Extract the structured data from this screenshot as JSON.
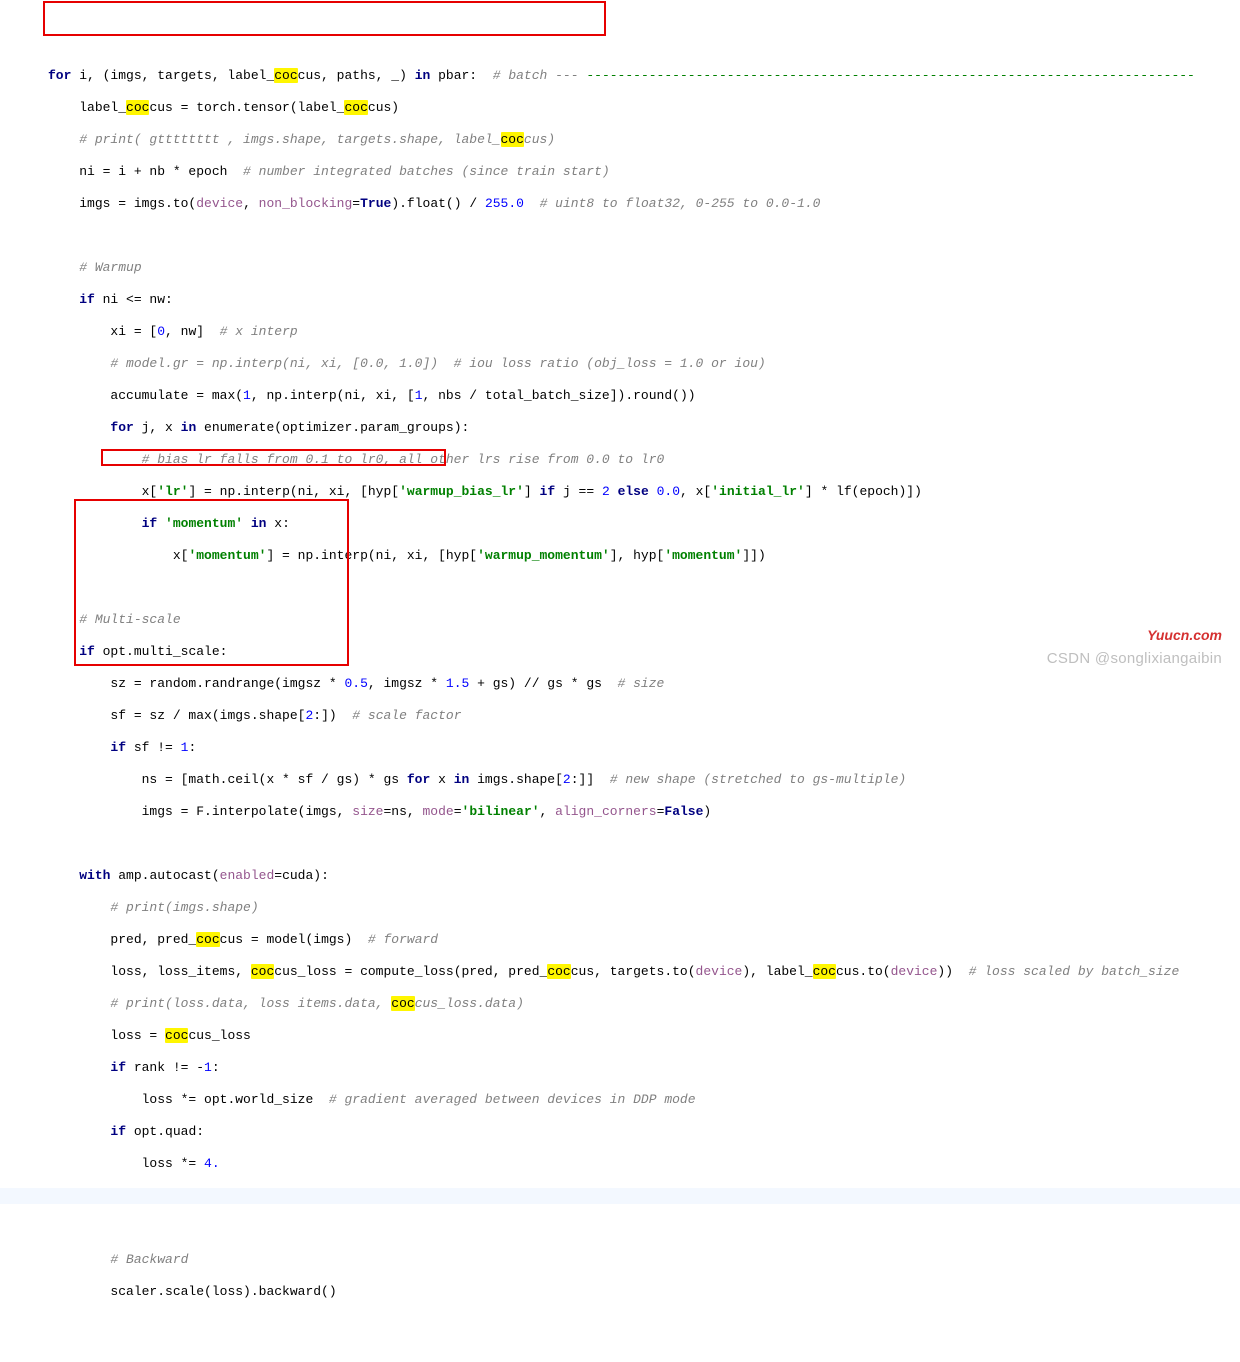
{
  "tokens": {
    "l01": {
      "pre": "",
      "a": "for",
      "b": " i, (imgs, targets, label_",
      "h1": "coc",
      "c": "cus, paths, _) ",
      "d": "in",
      "e": " pbar:  ",
      "cm": "# batch ---",
      "dash": " ------------------------------------------------------------------------------"
    },
    "l02": {
      "pre": "    ",
      "a": "label_",
      "h1": "coc",
      "b": "cus = torch.tensor(label_",
      "h2": "coc",
      "c": "cus)"
    },
    "l03": {
      "pre": "    ",
      "a": "# print( gtttttttt , imgs.shape, targets.shape, label_",
      "h": "coc",
      "b": "cus)"
    },
    "l04": {
      "pre": "    ",
      "a": "ni = i + nb * epoch  ",
      "cm": "# number integrated batches (since train start)"
    },
    "l05": {
      "pre": "    ",
      "a": "imgs = imgs.to(",
      "self": "device",
      "b": ", ",
      "kw": "non_blocking",
      "eq": "=",
      "tr": "True",
      "c": ").float() / ",
      "num": "255.0",
      "sp": "  ",
      "cm": "# uint8 to float32, 0-255 to 0.0-1.0"
    },
    "l07": {
      "pre": "    ",
      "cm": "# Warmup"
    },
    "l08": {
      "pre": "    ",
      "a": "if",
      "b": " ni <= nw:"
    },
    "l09": {
      "pre": "        ",
      "a": "xi = [",
      "n1": "0",
      "b": ", nw]  ",
      "cm": "# x interp"
    },
    "l10": {
      "pre": "        ",
      "cm": "# model.gr = np.interp(ni, xi, [0.0, 1.0])  # iou loss ratio (obj_loss = 1.0 or iou)"
    },
    "l11": {
      "pre": "        ",
      "a": "accumulate = max(",
      "n1": "1",
      "b": ", np.interp(ni, xi, [",
      "n2": "1",
      "c": ", nbs / total_batch_size]).round())"
    },
    "l12": {
      "pre": "        ",
      "a": "for",
      "b": " j, x ",
      "c": "in",
      "d": " enumerate(optimizer.param_groups):"
    },
    "l13": {
      "pre": "            ",
      "cm": "# bias lr falls from 0.1 to lr0, all other lrs rise from 0.0 to lr0"
    },
    "l14": {
      "pre": "            ",
      "a": "x[",
      "s1": "'lr'",
      "b": "] = np.interp(ni, xi, [hyp[",
      "s2": "'warmup_bias_lr'",
      "c": "] ",
      "if": "if",
      "d": " j == ",
      "n": "2",
      "sp": " ",
      "el": "else",
      "e": " ",
      "z": "0.0",
      "f": ", x[",
      "s3": "'initial_lr'",
      "g": "] * lf(epoch)])"
    },
    "l15": {
      "pre": "            ",
      "a": "if",
      "b": " ",
      "s": "'momentum'",
      "c": " ",
      "d": "in",
      "e": " x:"
    },
    "l16": {
      "pre": "                ",
      "a": "x[",
      "s1": "'momentum'",
      "b": "] = np.interp(ni, xi, [hyp[",
      "s2": "'warmup_momentum'",
      "c": "], hyp[",
      "s3": "'momentum'",
      "d": "]])"
    },
    "l18": {
      "pre": "    ",
      "cm": "# Multi-scale"
    },
    "l19": {
      "pre": "    ",
      "a": "if",
      "b": " opt.multi_scale:"
    },
    "l20": {
      "pre": "        ",
      "a": "sz = random.randrange(imgsz * ",
      "n1": "0.5",
      "b": ", imgsz * ",
      "n2": "1.5",
      "c": " + gs) // gs * gs  ",
      "cm": "# size"
    },
    "l21": {
      "pre": "        ",
      "a": "sf = sz / max(imgs.shape[",
      "n": "2",
      "b": ":])  ",
      "cm": "# scale factor"
    },
    "l22": {
      "pre": "        ",
      "a": "if",
      "b": " sf != ",
      "n": "1",
      "c": ":"
    },
    "l23": {
      "pre": "            ",
      "a": "ns = [math.ceil(x * sf / gs) * gs ",
      "fr": "for",
      "b": " x ",
      "in": "in",
      "c": " imgs.shape[",
      "n": "2",
      "d": ":]]  ",
      "cm": "# new shape (stretched to gs-multiple)"
    },
    "l24": {
      "pre": "            ",
      "a": "imgs = F.interpolate(imgs, ",
      "k1": "size",
      "eq1": "=ns, ",
      "k2": "mode",
      "eq2": "=",
      "s": "'bilinear'",
      "b": ", ",
      "k3": "align_corners",
      "eq3": "=",
      "fl": "False",
      "c": ")"
    },
    "l26": {
      "pre": "    ",
      "a": "with",
      "b": " amp.autocast(",
      "k": "enabled",
      "c": "=cuda):"
    },
    "l27": {
      "pre": "        ",
      "cm": "# print(imgs.shape)"
    },
    "l28": {
      "pre": "        ",
      "a": "pred, pred_",
      "h": "coc",
      "b": "cus = model(imgs)  ",
      "cm": "# forward"
    },
    "l29": {
      "pre": "        ",
      "a": "loss, loss_items, ",
      "h1": "coc",
      "b": "cus_loss = compute_loss(pred, pred_",
      "h2": "coc",
      "c": "cus, targets.to(",
      "self": "device",
      "d": "), label_",
      "h3": "coc",
      "e": "cus.to(",
      "self2": "device",
      "f": "))  ",
      "cm": "# loss scaled by batch_size"
    },
    "l30": {
      "pre": "        ",
      "a": "# print(loss.data, loss items.data, ",
      "h": "coc",
      "b": "cus_loss.data)"
    },
    "l31": {
      "pre": "        ",
      "a": "loss = ",
      "h": "coc",
      "b": "cus_loss"
    },
    "l32": {
      "pre": "        ",
      "a": "if",
      "b": " rank != -",
      "n": "1",
      "c": ":"
    },
    "l33": {
      "pre": "            ",
      "a": "loss *= opt.world_size  ",
      "cm": "# gradient averaged between devices in DDP mode"
    },
    "l34": {
      "pre": "        ",
      "a": "if",
      "b": " opt.quad:"
    },
    "l35": {
      "pre": "            ",
      "a": "loss *= ",
      "n": "4."
    },
    "l38": {
      "pre": "        ",
      "cm": "# Backward"
    },
    "l39": {
      "pre": "        ",
      "a": "scaler.scale(loss).backward()"
    }
  },
  "watermark1": "Yuucn.com",
  "watermark2": "CSDN @songlixiangaibin"
}
